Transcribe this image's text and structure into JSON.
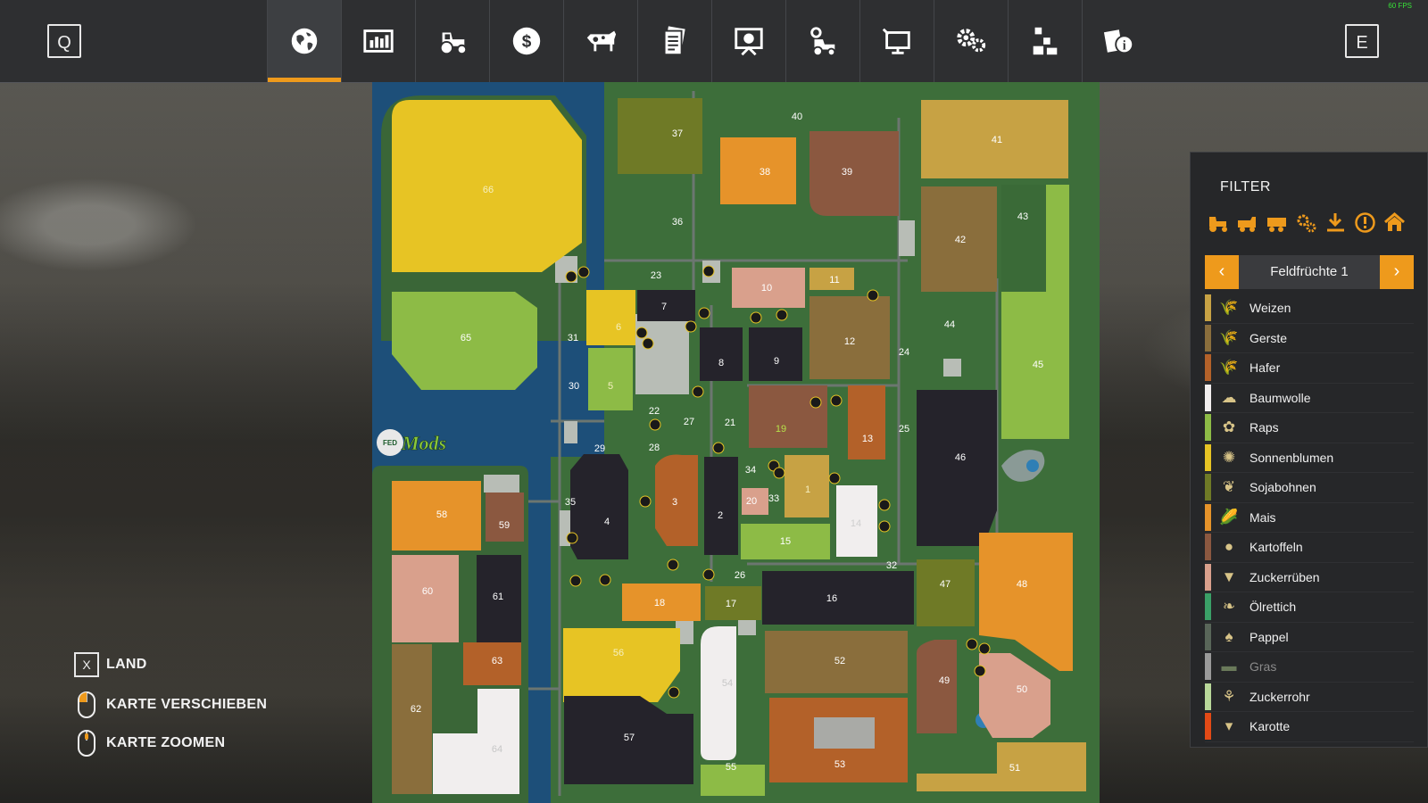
{
  "header": {
    "left_key": "Q",
    "right_key": "E",
    "fps": "60 FPS",
    "tabs": [
      {
        "name": "tab-map",
        "icon": "globe-icon",
        "active": true
      },
      {
        "name": "tab-statistics",
        "icon": "statistics-icon",
        "active": false
      },
      {
        "name": "tab-vehicles",
        "icon": "tractor-icon",
        "active": false
      },
      {
        "name": "tab-finances",
        "icon": "dollar-icon",
        "active": false
      },
      {
        "name": "tab-animals",
        "icon": "cow-icon",
        "active": false
      },
      {
        "name": "tab-contracts",
        "icon": "contracts-icon",
        "active": false
      },
      {
        "name": "tab-tutorial",
        "icon": "presentation-icon",
        "active": false
      },
      {
        "name": "tab-production",
        "icon": "production-icon",
        "active": false
      },
      {
        "name": "tab-multiplayer",
        "icon": "monitor-icon",
        "active": false
      },
      {
        "name": "tab-settings",
        "icon": "gear-icon",
        "active": false
      },
      {
        "name": "tab-controls",
        "icon": "blocks-icon",
        "active": false
      },
      {
        "name": "tab-help",
        "icon": "info-icon",
        "active": false
      }
    ]
  },
  "colors": {
    "accent": "#ee9a1c",
    "panel_bg": "#262729",
    "water": "#1d4f79",
    "grass": "#3d6e3a"
  },
  "map": {
    "watermark": "FED Mods",
    "fields": [
      {
        "id": "66",
        "crop": "Sonnenblumen"
      },
      {
        "id": "65",
        "crop": "Raps"
      },
      {
        "id": "37",
        "crop": "Sojabohnen"
      },
      {
        "id": "40",
        "crop": "Gras"
      },
      {
        "id": "38",
        "crop": "Mais"
      },
      {
        "id": "39",
        "crop": "Kartoffeln"
      },
      {
        "id": "41",
        "crop": "Weizen"
      },
      {
        "id": "36",
        "crop": "Gras"
      },
      {
        "id": "42",
        "crop": "Gerste"
      },
      {
        "id": "43",
        "crop": "Gras"
      },
      {
        "id": "23",
        "crop": "Gras"
      },
      {
        "id": "10",
        "crop": "Zuckerrüben"
      },
      {
        "id": "11",
        "crop": "Weizen"
      },
      {
        "id": "7",
        "crop": "none"
      },
      {
        "id": "6",
        "crop": "Sonnenblumen"
      },
      {
        "id": "31",
        "crop": "Gras"
      },
      {
        "id": "12",
        "crop": "Gerste"
      },
      {
        "id": "44",
        "crop": "Gras"
      },
      {
        "id": "45",
        "crop": "Raps"
      },
      {
        "id": "8",
        "crop": "none"
      },
      {
        "id": "9",
        "crop": "none"
      },
      {
        "id": "24",
        "crop": "Gras"
      },
      {
        "id": "30",
        "crop": "Gras"
      },
      {
        "id": "5",
        "crop": "Raps"
      },
      {
        "id": "22",
        "crop": "Gras"
      },
      {
        "id": "27",
        "crop": "Gras"
      },
      {
        "id": "21",
        "crop": "Gras"
      },
      {
        "id": "19",
        "crop": "Kartoffeln"
      },
      {
        "id": "13",
        "crop": "Hafer"
      },
      {
        "id": "25",
        "crop": "Gras"
      },
      {
        "id": "46",
        "crop": "none"
      },
      {
        "id": "29",
        "crop": "Gras"
      },
      {
        "id": "28",
        "crop": "Gras"
      },
      {
        "id": "34",
        "crop": "Gras"
      },
      {
        "id": "1",
        "crop": "Weizen"
      },
      {
        "id": "58",
        "crop": "Mais"
      },
      {
        "id": "59",
        "crop": "Kartoffeln"
      },
      {
        "id": "4",
        "crop": "none"
      },
      {
        "id": "3",
        "crop": "Hafer"
      },
      {
        "id": "2",
        "crop": "none"
      },
      {
        "id": "20",
        "crop": "Zuckerrüben"
      },
      {
        "id": "33",
        "crop": "Gras"
      },
      {
        "id": "14",
        "crop": "Baumwolle"
      },
      {
        "id": "35",
        "crop": "Gras"
      },
      {
        "id": "15",
        "crop": "Raps"
      },
      {
        "id": "60",
        "crop": "Zuckerrüben"
      },
      {
        "id": "61",
        "crop": "none"
      },
      {
        "id": "32",
        "crop": "Gras"
      },
      {
        "id": "26",
        "crop": "Gras"
      },
      {
        "id": "18",
        "crop": "Mais"
      },
      {
        "id": "17",
        "crop": "Sojabohnen"
      },
      {
        "id": "16",
        "crop": "none"
      },
      {
        "id": "47",
        "crop": "Sojabohnen"
      },
      {
        "id": "48",
        "crop": "Mais"
      },
      {
        "id": "63",
        "crop": "Hafer"
      },
      {
        "id": "56",
        "crop": "Sonnenblumen"
      },
      {
        "id": "54",
        "crop": "Baumwolle"
      },
      {
        "id": "52",
        "crop": "Gerste"
      },
      {
        "id": "49",
        "crop": "Kartoffeln"
      },
      {
        "id": "50",
        "crop": "Zuckerrüben"
      },
      {
        "id": "62",
        "crop": "Gerste"
      },
      {
        "id": "64",
        "crop": "Baumwolle"
      },
      {
        "id": "57",
        "crop": "none"
      },
      {
        "id": "55",
        "crop": "Raps"
      },
      {
        "id": "53",
        "crop": "Hafer"
      },
      {
        "id": "51",
        "crop": "Weizen"
      }
    ]
  },
  "filter": {
    "title": "FILTER",
    "icons": [
      "tractor-icon",
      "harvester-icon",
      "trailer-icon",
      "gears-icon",
      "download-icon",
      "warning-icon",
      "home-icon"
    ],
    "selector_label": "Feldfrüchte 1",
    "crops": [
      {
        "label": "Weizen",
        "color": "#c7a244",
        "icon": "wheat-icon"
      },
      {
        "label": "Gerste",
        "color": "#8a6e3c",
        "icon": "barley-icon"
      },
      {
        "label": "Hafer",
        "color": "#b36129",
        "icon": "oat-icon"
      },
      {
        "label": "Baumwolle",
        "color": "#f1eeee",
        "icon": "cotton-icon"
      },
      {
        "label": "Raps",
        "color": "#8dbb46",
        "icon": "canola-icon"
      },
      {
        "label": "Sonnenblumen",
        "color": "#e7c424",
        "icon": "sunflower-icon"
      },
      {
        "label": "Sojabohnen",
        "color": "#6f7a26",
        "icon": "soybean-icon"
      },
      {
        "label": "Mais",
        "color": "#e6932a",
        "icon": "corn-icon"
      },
      {
        "label": "Kartoffeln",
        "color": "#8b5840",
        "icon": "potato-icon"
      },
      {
        "label": "Zuckerrüben",
        "color": "#d9a08c",
        "icon": "sugarbeet-icon"
      },
      {
        "label": "Ölrettich",
        "color": "#3aa067",
        "icon": "oilradish-icon"
      },
      {
        "label": "Pappel",
        "color": "#596659",
        "icon": "poplar-icon"
      },
      {
        "label": "Gras",
        "color": "#9a9a9a",
        "icon": "grass-icon",
        "dim": true
      },
      {
        "label": "Zuckerrohr",
        "color": "#b9d89a",
        "icon": "sugarcane-icon"
      },
      {
        "label": "Karotte",
        "color": "#e34a16",
        "icon": "carrot-icon"
      }
    ]
  },
  "controls": [
    {
      "key": "X",
      "label": "LAND"
    },
    {
      "key": "",
      "label": "KARTE VERSCHIEBEN"
    },
    {
      "key": "",
      "label": "KARTE ZOOMEN"
    }
  ]
}
